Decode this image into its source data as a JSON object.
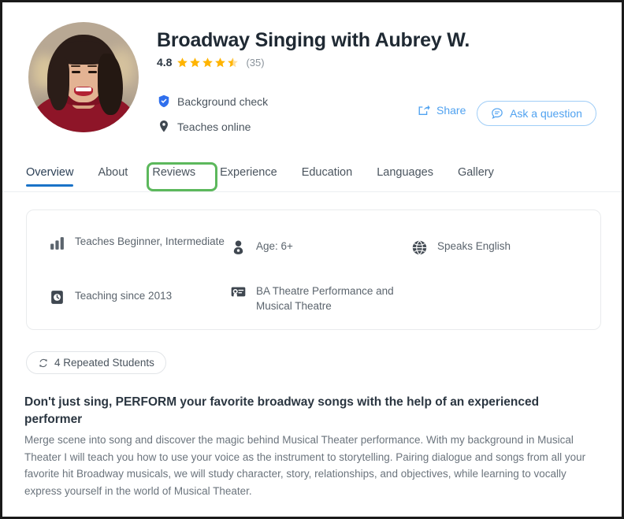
{
  "profile": {
    "name": "Broadway Singing with Aubrey W.",
    "rating": "4.8",
    "rating_count": "(35)",
    "stars_filled": 4,
    "stars_half": 1,
    "badges": [
      {
        "icon": "shield-check-icon",
        "label": "Background check"
      },
      {
        "icon": "location-pin-icon",
        "label": "Teaches online"
      }
    ],
    "avatar_alt": "tutor-photo"
  },
  "actions": {
    "share_label": "Share",
    "ask_label": "Ask a question"
  },
  "tabs": [
    {
      "label": "Overview",
      "active": true
    },
    {
      "label": "About",
      "active": false
    },
    {
      "label": "Reviews",
      "active": false,
      "highlighted": true
    },
    {
      "label": "Experience",
      "active": false
    },
    {
      "label": "Education",
      "active": false
    },
    {
      "label": "Languages",
      "active": false
    },
    {
      "label": "Gallery",
      "active": false
    }
  ],
  "info_card": {
    "levels": "Teaches Beginner, Intermediate",
    "age": "Age: 6+",
    "language": "Speaks English",
    "teaching_since": "Teaching since 2013",
    "degree": "BA Theatre Performance and Musical Theatre"
  },
  "repeated_students": {
    "label": "4 Repeated Students"
  },
  "description": {
    "title": "Don't just sing, PERFORM your favorite broadway songs with the help of an experienced performer",
    "body": "Merge scene into song and discover the magic behind Musical Theater performance. With my background in Musical Theater I will teach you how to use your voice as the instrument to storytelling. Pairing dialogue and songs from all your favorite hit Broadway musicals, we will study character, story, relationships, and objectives, while learning to vocally express yourself in the world of Musical Theater."
  },
  "colors": {
    "star": "#ffb400",
    "link_blue": "#50a2f0",
    "active_tab_underline": "#1a73c8",
    "shield_blue": "#2f6fed",
    "highlight_green": "#5cb85c"
  }
}
